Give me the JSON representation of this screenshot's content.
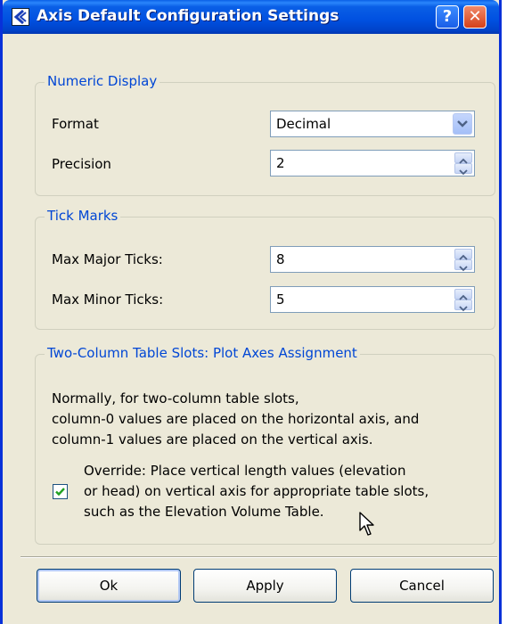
{
  "window": {
    "title": "Axis Default Configuration Settings",
    "help_label": "?",
    "close_label": "✕"
  },
  "numeric_display": {
    "legend": "Numeric Display",
    "format_label": "Format",
    "format_value": "Decimal",
    "precision_label": "Precision",
    "precision_value": "2"
  },
  "tick_marks": {
    "legend": "Tick Marks",
    "major_label": "Max Major Ticks:",
    "major_value": "8",
    "minor_label": "Max Minor Ticks:",
    "minor_value": "5"
  },
  "table_slots": {
    "legend": "Two-Column Table Slots: Plot Axes Assignment",
    "description": [
      "Normally, for two-column table slots,",
      "column-0 values are placed on the horizontal axis, and",
      "column-1 values are placed on the vertical axis."
    ],
    "override_checked": true,
    "override_text": [
      "Override: Place vertical length values (elevation",
      "or head) on vertical axis for appropriate table slots,",
      "such as the Elevation Volume Table."
    ]
  },
  "buttons": {
    "ok": "Ok",
    "apply": "Apply",
    "cancel": "Cancel"
  },
  "colors": {
    "title_bar": "#0050e0",
    "legend_text": "#0046d5",
    "dialog_bg": "#ece9d8",
    "checkbox_check": "#21a121"
  },
  "icons": [
    "app-logo-icon",
    "help-icon",
    "close-icon",
    "dropdown-arrow-icon",
    "spinner-up-icon",
    "spinner-down-icon",
    "checkmark-icon",
    "mouse-cursor-icon"
  ]
}
